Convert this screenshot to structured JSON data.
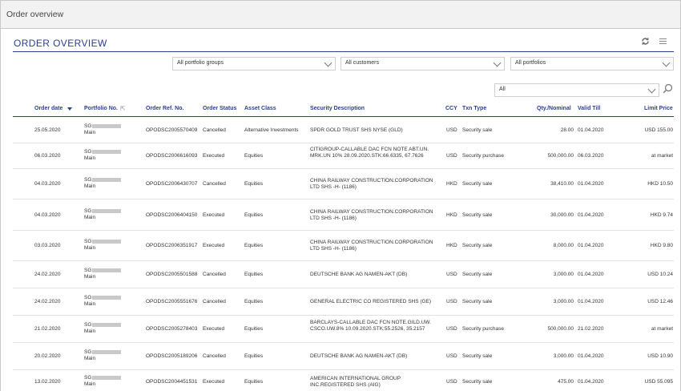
{
  "window": {
    "title": "Order overview"
  },
  "panel": {
    "title": "ORDER OVERVIEW",
    "refresh_icon": "refresh-icon",
    "menu_icon": "menu-icon"
  },
  "filters": {
    "portfolio_groups": "All portfolio groups",
    "customers": "All customers",
    "portfolios": "All portfolios",
    "status": "All"
  },
  "columns": {
    "order_date": "Order date",
    "portfolio_no": "Portfolio No.",
    "order_ref": "Order Ref. No.",
    "order_status": "Order Status",
    "asset_class": "Asset Class",
    "security": "Security Description",
    "ccy": "CCY",
    "txn_type": "Txn Type",
    "qty": "Qty./Nominal",
    "valid_till": "Valid Till",
    "limit_price": "Limit Price"
  },
  "rows": [
    {
      "date": "25.05.2020",
      "portfolio": "SG",
      "portfolio_sub": "Main",
      "ref": "OPODSC2005570409",
      "status": "Cancelled",
      "asset": "Alternative Investments",
      "security": "SPDR GOLD TRUST SHS NYSE (GLD)",
      "ccy": "USD",
      "txn": "Security sale",
      "qty": "28.00",
      "valid": "01.04.2020",
      "limit": "USD 155.00"
    },
    {
      "date": "06.03.2020",
      "portfolio": "SG",
      "portfolio_sub": "Main",
      "ref": "OPODSC2006616093",
      "status": "Executed",
      "asset": "Equities",
      "security": "CITIGROUP-CALLABLE DAC FCN NOTE ABT.UN. MRK.UN 10% 28.09.2020.STK:66.6335, 67.7626",
      "ccy": "USD",
      "txn": "Security purchase",
      "qty": "500,000.00",
      "valid": "06.03.2020",
      "limit": "at market"
    },
    {
      "date": "04.03.2020",
      "portfolio": "SG",
      "portfolio_sub": "Main",
      "ref": "OPODSC2006430707",
      "status": "Cancelled",
      "asset": "Equities",
      "security": "CHINA RAILWAY CONSTRUCTION.CORPORATION LTD SHS -H- (1186)",
      "ccy": "HKD",
      "txn": "Security sale",
      "qty": "38,410.00",
      "valid": "01.04.2020",
      "limit": "HKD 10.50"
    },
    {
      "date": "04.03.2020",
      "portfolio": "SG",
      "portfolio_sub": "Main",
      "ref": "OPODSC2006404150",
      "status": "Executed",
      "asset": "Equities",
      "security": "CHINA RAILWAY CONSTRUCTION.CORPORATION LTD SHS -H- (1186)",
      "ccy": "HKD",
      "txn": "Security sale",
      "qty": "30,000.00",
      "valid": "01.04.2020",
      "limit": "HKD 9.74"
    },
    {
      "date": "03.03.2020",
      "portfolio": "SG",
      "portfolio_sub": "Main",
      "ref": "OPODSC2006351917",
      "status": "Executed",
      "asset": "Equities",
      "security": "CHINA RAILWAY CONSTRUCTION.CORPORATION LTD SHS -H- (1186)",
      "ccy": "HKD",
      "txn": "Security sale",
      "qty": "8,000.00",
      "valid": "01.04.2020",
      "limit": "HKD 9.80"
    },
    {
      "date": "24.02.2020",
      "portfolio": "SG",
      "portfolio_sub": "Main",
      "ref": "OPODSC2005501588",
      "status": "Cancelled",
      "asset": "Equities",
      "security": "DEUTSCHE BANK AG NAMEN-AKT (DB)",
      "ccy": "USD",
      "txn": "Security sale",
      "qty": "3,000.00",
      "valid": "01.04.2020",
      "limit": "USD 10.24"
    },
    {
      "date": "24.02.2020",
      "portfolio": "SG",
      "portfolio_sub": "Main",
      "ref": "OPODSC2005551676",
      "status": "Cancelled",
      "asset": "Equities",
      "security": "GENERAL ELECTRIC CO REGISTERED SHS (GE)",
      "ccy": "USD",
      "txn": "Security sale",
      "qty": "3,000.00",
      "valid": "01.04.2020",
      "limit": "USD 12.46"
    },
    {
      "date": "21.02.2020",
      "portfolio": "SG",
      "portfolio_sub": "Main",
      "ref": "OPODSC2005278403",
      "status": "Executed",
      "asset": "Equities",
      "security": "BARCLAYS-CALLABLE DAC FCN NOTE.GILD.UW. CSCO.UW.8% 10.09.2020.STK:55.2526, 35.2157",
      "ccy": "USD",
      "txn": "Security purchase",
      "qty": "500,000.00",
      "valid": "21.02.2020",
      "limit": "at market"
    },
    {
      "date": "20.02.2020",
      "portfolio": "SG",
      "portfolio_sub": "Main",
      "ref": "OPODSC2005189206",
      "status": "Cancelled",
      "asset": "Equities",
      "security": "DEUTSCHE BANK AG NAMEN-AKT (DB)",
      "ccy": "USD",
      "txn": "Security sale",
      "qty": "3,000.00",
      "valid": "01.04.2020",
      "limit": "USD 10.90"
    },
    {
      "date": "13.02.2020",
      "portfolio": "SG",
      "portfolio_sub": "Main",
      "ref": "OPODSC2004451531",
      "status": "Executed",
      "asset": "Equities",
      "security": "AMERICAN INTERNATIONAL GROUP INC.REGISTERED SHS (AIG)",
      "ccy": "USD",
      "txn": "Security sale",
      "qty": "475.00",
      "valid": "01.04.2020",
      "limit": "USD 55.095"
    }
  ]
}
